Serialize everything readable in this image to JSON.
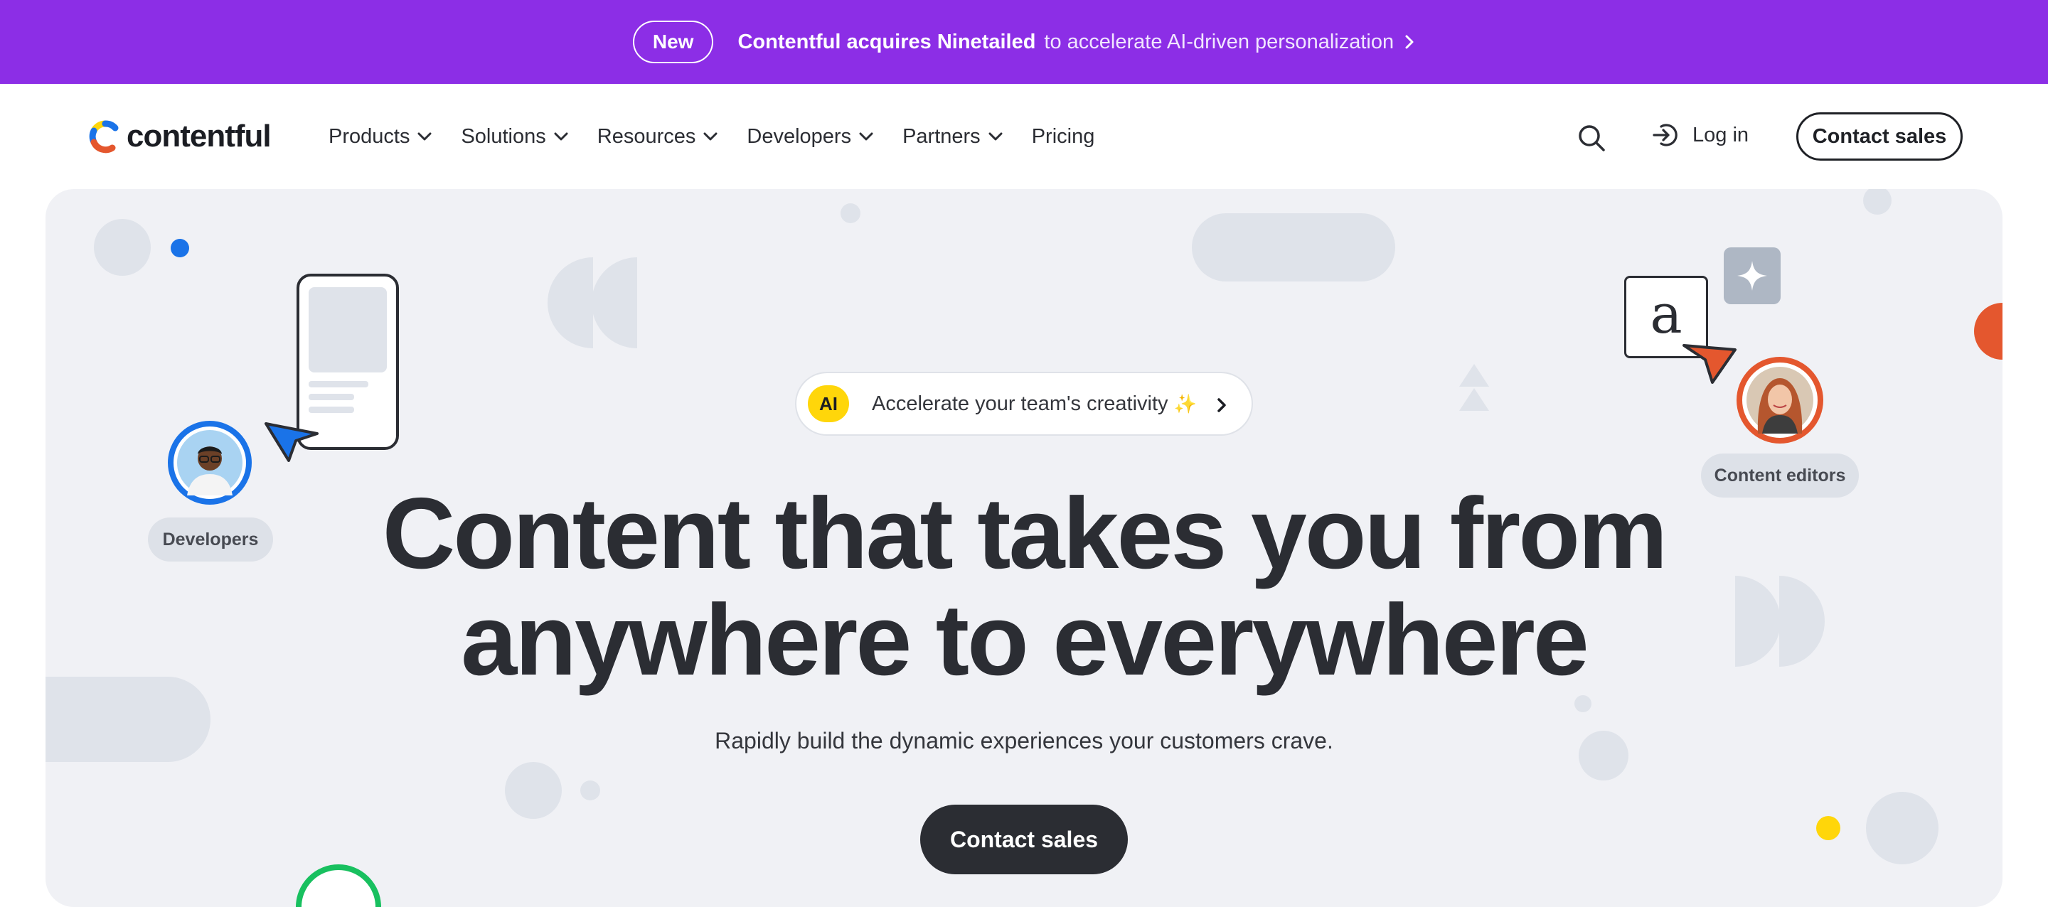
{
  "banner": {
    "badge": "New",
    "headline": "Contentful acquires Ninetailed",
    "text": "to accelerate AI-driven personalization"
  },
  "nav": {
    "logo_text": "contentful",
    "items": [
      {
        "label": "Products"
      },
      {
        "label": "Solutions"
      },
      {
        "label": "Resources"
      },
      {
        "label": "Developers"
      },
      {
        "label": "Partners"
      },
      {
        "label": "Pricing"
      }
    ],
    "login_label": "Log in",
    "contact_label": "Contact sales"
  },
  "hero": {
    "ai_badge": "AI",
    "ai_text": "Accelerate your team's creativity",
    "ai_emoji": "✨",
    "headline_line1": "Content that takes you from",
    "headline_line2": "anywhere to everywhere",
    "subheadline": "Rapidly build the dynamic experiences your customers crave.",
    "cta_label": "Contact sales",
    "personas": {
      "left": "Developers",
      "right": "Content editors"
    },
    "letter_card": "a"
  },
  "colors": {
    "banner_bg": "#8c2ee6",
    "hero_bg": "#f0f1f5",
    "dark": "#2b2d33",
    "ai_yellow": "#ffd60a",
    "blue": "#1a73e8",
    "orange": "#e4572e",
    "green": "#18c05f"
  }
}
